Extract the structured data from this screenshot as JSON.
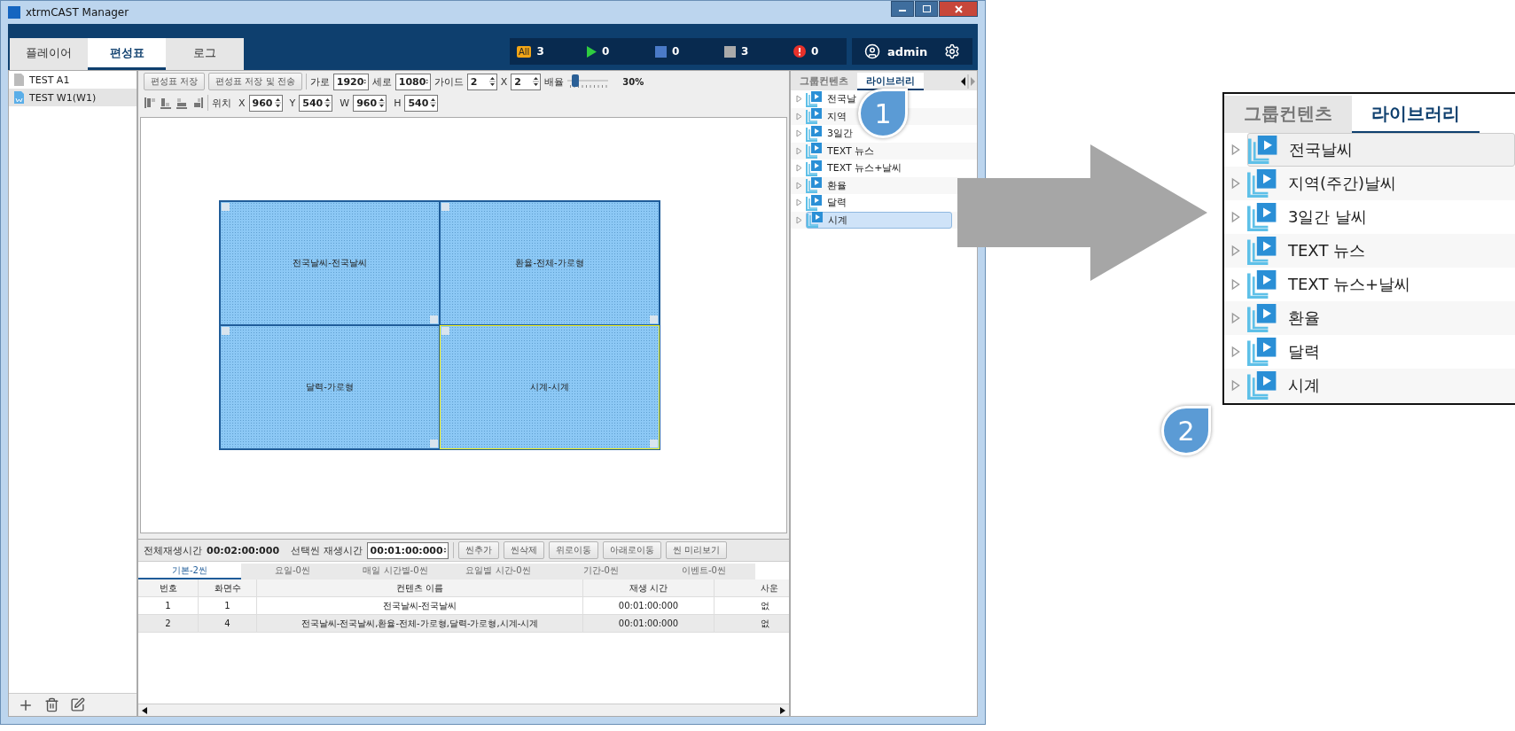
{
  "window": {
    "title": "xtrmCAST Manager"
  },
  "main_tabs": [
    {
      "label": "플레이어",
      "selected": false
    },
    {
      "label": "편성표",
      "selected": true
    },
    {
      "label": "로그",
      "selected": false
    }
  ],
  "status": [
    {
      "kind": "all",
      "label": "All",
      "count": "3"
    },
    {
      "kind": "play",
      "count": "0"
    },
    {
      "kind": "blue",
      "count": "0"
    },
    {
      "kind": "gray",
      "count": "3"
    },
    {
      "kind": "error",
      "count": "0"
    }
  ],
  "user": {
    "name": "admin"
  },
  "schedules": [
    {
      "label": "TEST A1",
      "kind": "doc",
      "selected": false
    },
    {
      "label": "TEST W1(W1)",
      "kind": "wide",
      "selected": true
    }
  ],
  "toolbar": {
    "buttons": [
      "편성표 저장",
      "편성표 저장 및 전송"
    ],
    "size_fields": [
      {
        "label": "가로",
        "value": "1920"
      },
      {
        "label": "세로",
        "value": "1080"
      },
      {
        "label": "가이드",
        "value": "2"
      },
      {
        "label": "X",
        "value": "2"
      }
    ],
    "zoom": {
      "label": "배율",
      "level": 0.12,
      "reading": "30%"
    },
    "position_label": "위치",
    "position_fields": [
      {
        "label": "X",
        "value": "960"
      },
      {
        "label": "Y",
        "value": "540"
      },
      {
        "label": "W",
        "value": "960"
      },
      {
        "label": "H",
        "value": "540"
      }
    ]
  },
  "canvas": {
    "cells": [
      {
        "label": "전국날씨-전국날씨",
        "selected": false
      },
      {
        "label": "환율-전체-가로형",
        "selected": false
      },
      {
        "label": "달력-가로형",
        "selected": false
      },
      {
        "label": "시계-시계",
        "selected": true
      }
    ]
  },
  "scene_bar": {
    "total_label": "전체재생시간",
    "total": "00:02:00:000",
    "selected_label": "선택씬 재생시간",
    "selected_value": "00:01:00:000",
    "buttons": [
      "씬추가",
      "씬삭제",
      "위로이동",
      "아래로이동",
      "씬 미리보기"
    ]
  },
  "scene_tabs": [
    {
      "label": "기본-2씬",
      "selected": true
    },
    {
      "label": "요일-0씬",
      "selected": false
    },
    {
      "label": "매일 시간별-0씬",
      "selected": false
    },
    {
      "label": "요일별 시간-0씬",
      "selected": false
    },
    {
      "label": "기간-0씬",
      "selected": false
    },
    {
      "label": "이벤트-0씬",
      "selected": false
    }
  ],
  "table": {
    "columns": [
      "번호",
      "화면수",
      "컨텐츠 이름",
      "재생 시간",
      "사운"
    ],
    "rows": [
      [
        "1",
        "1",
        "전국날씨-전국날씨",
        "00:01:00:000",
        "없"
      ],
      [
        "2",
        "4",
        "전국날씨-전국날씨,환율-전체-가로형,달력-가로형,시계-시계",
        "00:01:00:000",
        "없"
      ]
    ]
  },
  "library": {
    "tabs": [
      {
        "label": "그룹컨텐츠",
        "selected": false
      },
      {
        "label": "라이브러리",
        "selected": true
      }
    ],
    "items": [
      {
        "label": "전국날",
        "selected": false
      },
      {
        "label": "지역",
        "selected": false
      },
      {
        "label": "3일간",
        "selected": false
      },
      {
        "label": "TEXT 뉴스",
        "selected": false
      },
      {
        "label": "TEXT 뉴스+날씨",
        "selected": false
      },
      {
        "label": "환율",
        "selected": false
      },
      {
        "label": "달력",
        "selected": false
      },
      {
        "label": "시계",
        "selected": true
      }
    ]
  },
  "inset": {
    "tabs": [
      {
        "label": "그룹컨텐츠",
        "selected": false
      },
      {
        "label": "라이브러리",
        "selected": true
      }
    ],
    "items": [
      {
        "label": "전국날씨",
        "selected": true
      },
      {
        "label": "지역(주간)날씨",
        "selected": false
      },
      {
        "label": "3일간 날씨",
        "selected": false
      },
      {
        "label": "TEXT 뉴스",
        "selected": false
      },
      {
        "label": "TEXT 뉴스+날씨",
        "selected": false
      },
      {
        "label": "환율",
        "selected": false
      },
      {
        "label": "달력",
        "selected": false
      },
      {
        "label": "시계",
        "selected": false
      }
    ]
  },
  "callouts": [
    "1",
    "2"
  ]
}
